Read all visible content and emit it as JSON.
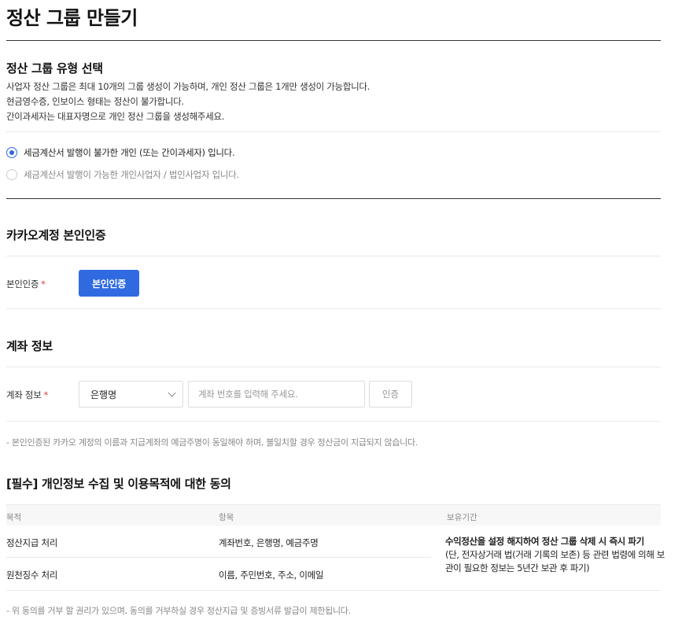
{
  "page": {
    "title": "정산 그룹 만들기"
  },
  "group_type": {
    "title": "정산 그룹 유형 선택",
    "desc": [
      "사업자 정산 그룹은 최대 10개의 그룹 생성이 가능하며, 개인 정산 그룹은 1개만 생성이 가능합니다.",
      "현금영수증, 인보이스 형태는 정산이 불가합니다.",
      "간이과세자는 대표자명으로 개인 정산 그룹을 생성해주세요."
    ],
    "options": [
      {
        "label": "세금계산서 발행이 불가한 개인 (또는 간이과세자) 입니다.",
        "selected": true
      },
      {
        "label": "세금계산서 발행이 가능한 개인사업자 / 법인사업자 입니다.",
        "selected": false
      }
    ]
  },
  "kakao_auth": {
    "title": "카카오계정 본인인증",
    "label": "본인인증",
    "required_mark": "*",
    "button": "본인인증"
  },
  "account": {
    "title": "계좌 정보",
    "label": "계좌 정보",
    "required_mark": "*",
    "bank_select": "은행명",
    "number_placeholder": "계좌 번호를 입력해 주세요.",
    "verify_button": "인증",
    "note": "- 본인인증된 카카오 계정의 이름과 지급계좌의 예금주명이 동일해야 하며, 불일치할 경우 정산금이 지급되지 않습니다."
  },
  "privacy": {
    "title": "[필수] 개인정보 수집 및 이용목적에 대한 동의",
    "headers": [
      "목적",
      "항목",
      "보유기간"
    ],
    "rows": [
      {
        "purpose": "정산지급 처리",
        "items": "계좌번호, 은행명, 예금주명"
      },
      {
        "purpose": "원천징수 처리",
        "items": "이름, 주민번호, 주소, 이메일"
      }
    ],
    "retention_bold": "수익정산을 설정 해지하여 정산 그룹 삭제 시 즉시 파기",
    "retention_detail": "(단, 전자상거래 법(거래 기록의 보존) 등 관련 법령에 의해 보관이 필요한 정보는 5년간 보관 후 파기)",
    "note": "- 위 동의를 거부 할 권리가 있으며, 동의를 거부하실 경우 정산지급 및 증빙서류 발급이 제한됩니다."
  },
  "colors": {
    "accent": "#2f6ae0",
    "required": "#e03c3c"
  }
}
